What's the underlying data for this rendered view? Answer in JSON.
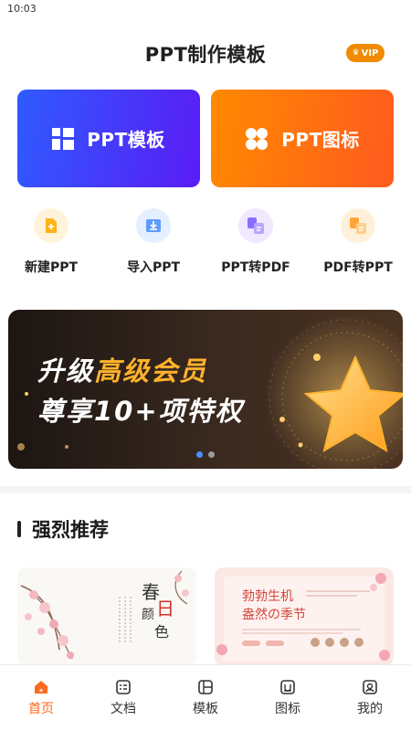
{
  "status_bar": {
    "time": "10:03"
  },
  "header": {
    "title": "PPT制作模板",
    "vip_label": "VIP"
  },
  "cards": [
    {
      "label": "PPT模板",
      "icon": "grid-layout-icon"
    },
    {
      "label": "PPT图标",
      "icon": "clover-icon"
    }
  ],
  "quick_actions": [
    {
      "label": "新建PPT",
      "icon": "new-file-icon"
    },
    {
      "label": "导入PPT",
      "icon": "import-icon"
    },
    {
      "label": "PPT转PDF",
      "icon": "ppt-to-pdf-icon"
    },
    {
      "label": "PDF转PPT",
      "icon": "pdf-to-ppt-icon"
    }
  ],
  "banner": {
    "line1_white": "升级",
    "line1_gold": "高级会员",
    "line2": "尊享10+项特权",
    "page_count": 2,
    "active_page": 1
  },
  "section": {
    "title": "强烈推荐"
  },
  "tabs": [
    {
      "label": "首页",
      "icon": "home-icon",
      "active": true
    },
    {
      "label": "文档",
      "icon": "document-icon",
      "active": false
    },
    {
      "label": "模板",
      "icon": "template-icon",
      "active": false
    },
    {
      "label": "图标",
      "icon": "icon-library-icon",
      "active": false
    },
    {
      "label": "我的",
      "icon": "profile-icon",
      "active": false
    }
  ],
  "colors": {
    "accent_orange": "#ff6a1f",
    "vip_orange": "#f08a00",
    "card_blue": "#2f5bff",
    "card_purple": "#5a1cf5",
    "banner_gold": "#ffb22c",
    "dot_active": "#4a8dff"
  }
}
